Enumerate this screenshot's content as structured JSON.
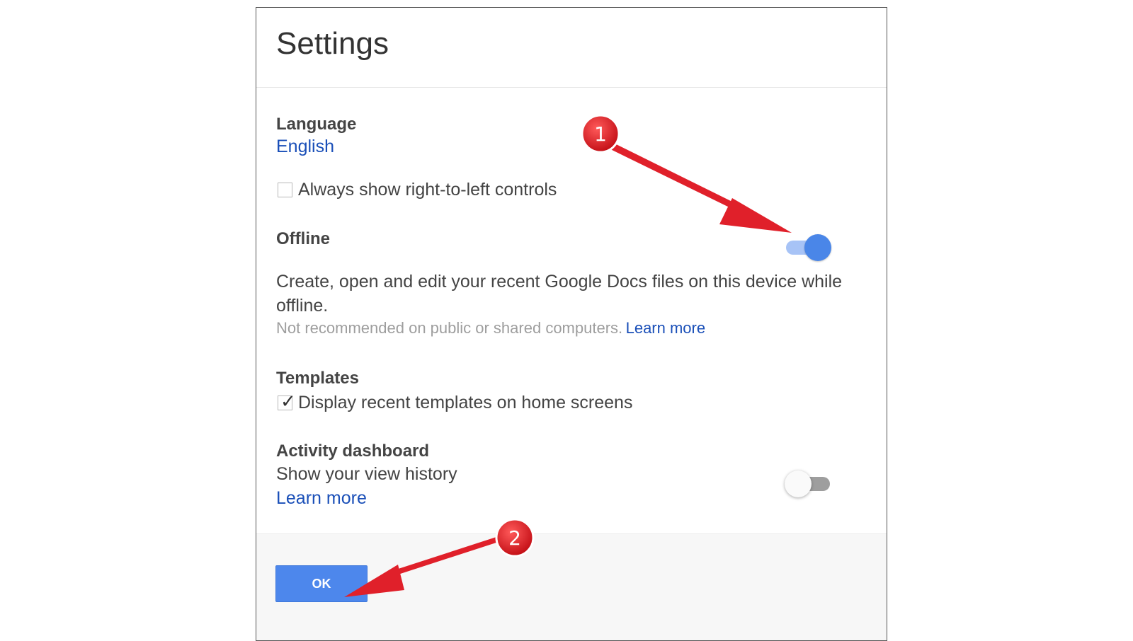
{
  "dialog": {
    "title": "Settings"
  },
  "language": {
    "label": "Language",
    "value": "English",
    "rtl_checkbox": {
      "label": "Always show right-to-left controls",
      "checked": false
    }
  },
  "offline": {
    "label": "Offline",
    "enabled": true,
    "description": "Create, open and edit your recent Google Docs files on this device while offline.",
    "note": "Not recommended on public or shared computers.",
    "learn_more": "Learn more"
  },
  "templates": {
    "label": "Templates",
    "checkbox": {
      "label": "Display recent templates on home screens",
      "checked": true
    }
  },
  "activity": {
    "label": "Activity dashboard",
    "description": "Show your view history",
    "learn_more": "Learn more",
    "enabled": false
  },
  "footer": {
    "ok_label": "OK"
  },
  "annotations": {
    "marker1": "1",
    "marker2": "2",
    "color": "#e0202a"
  },
  "colors": {
    "accent": "#4d87ec",
    "link": "#1a4fb8"
  }
}
